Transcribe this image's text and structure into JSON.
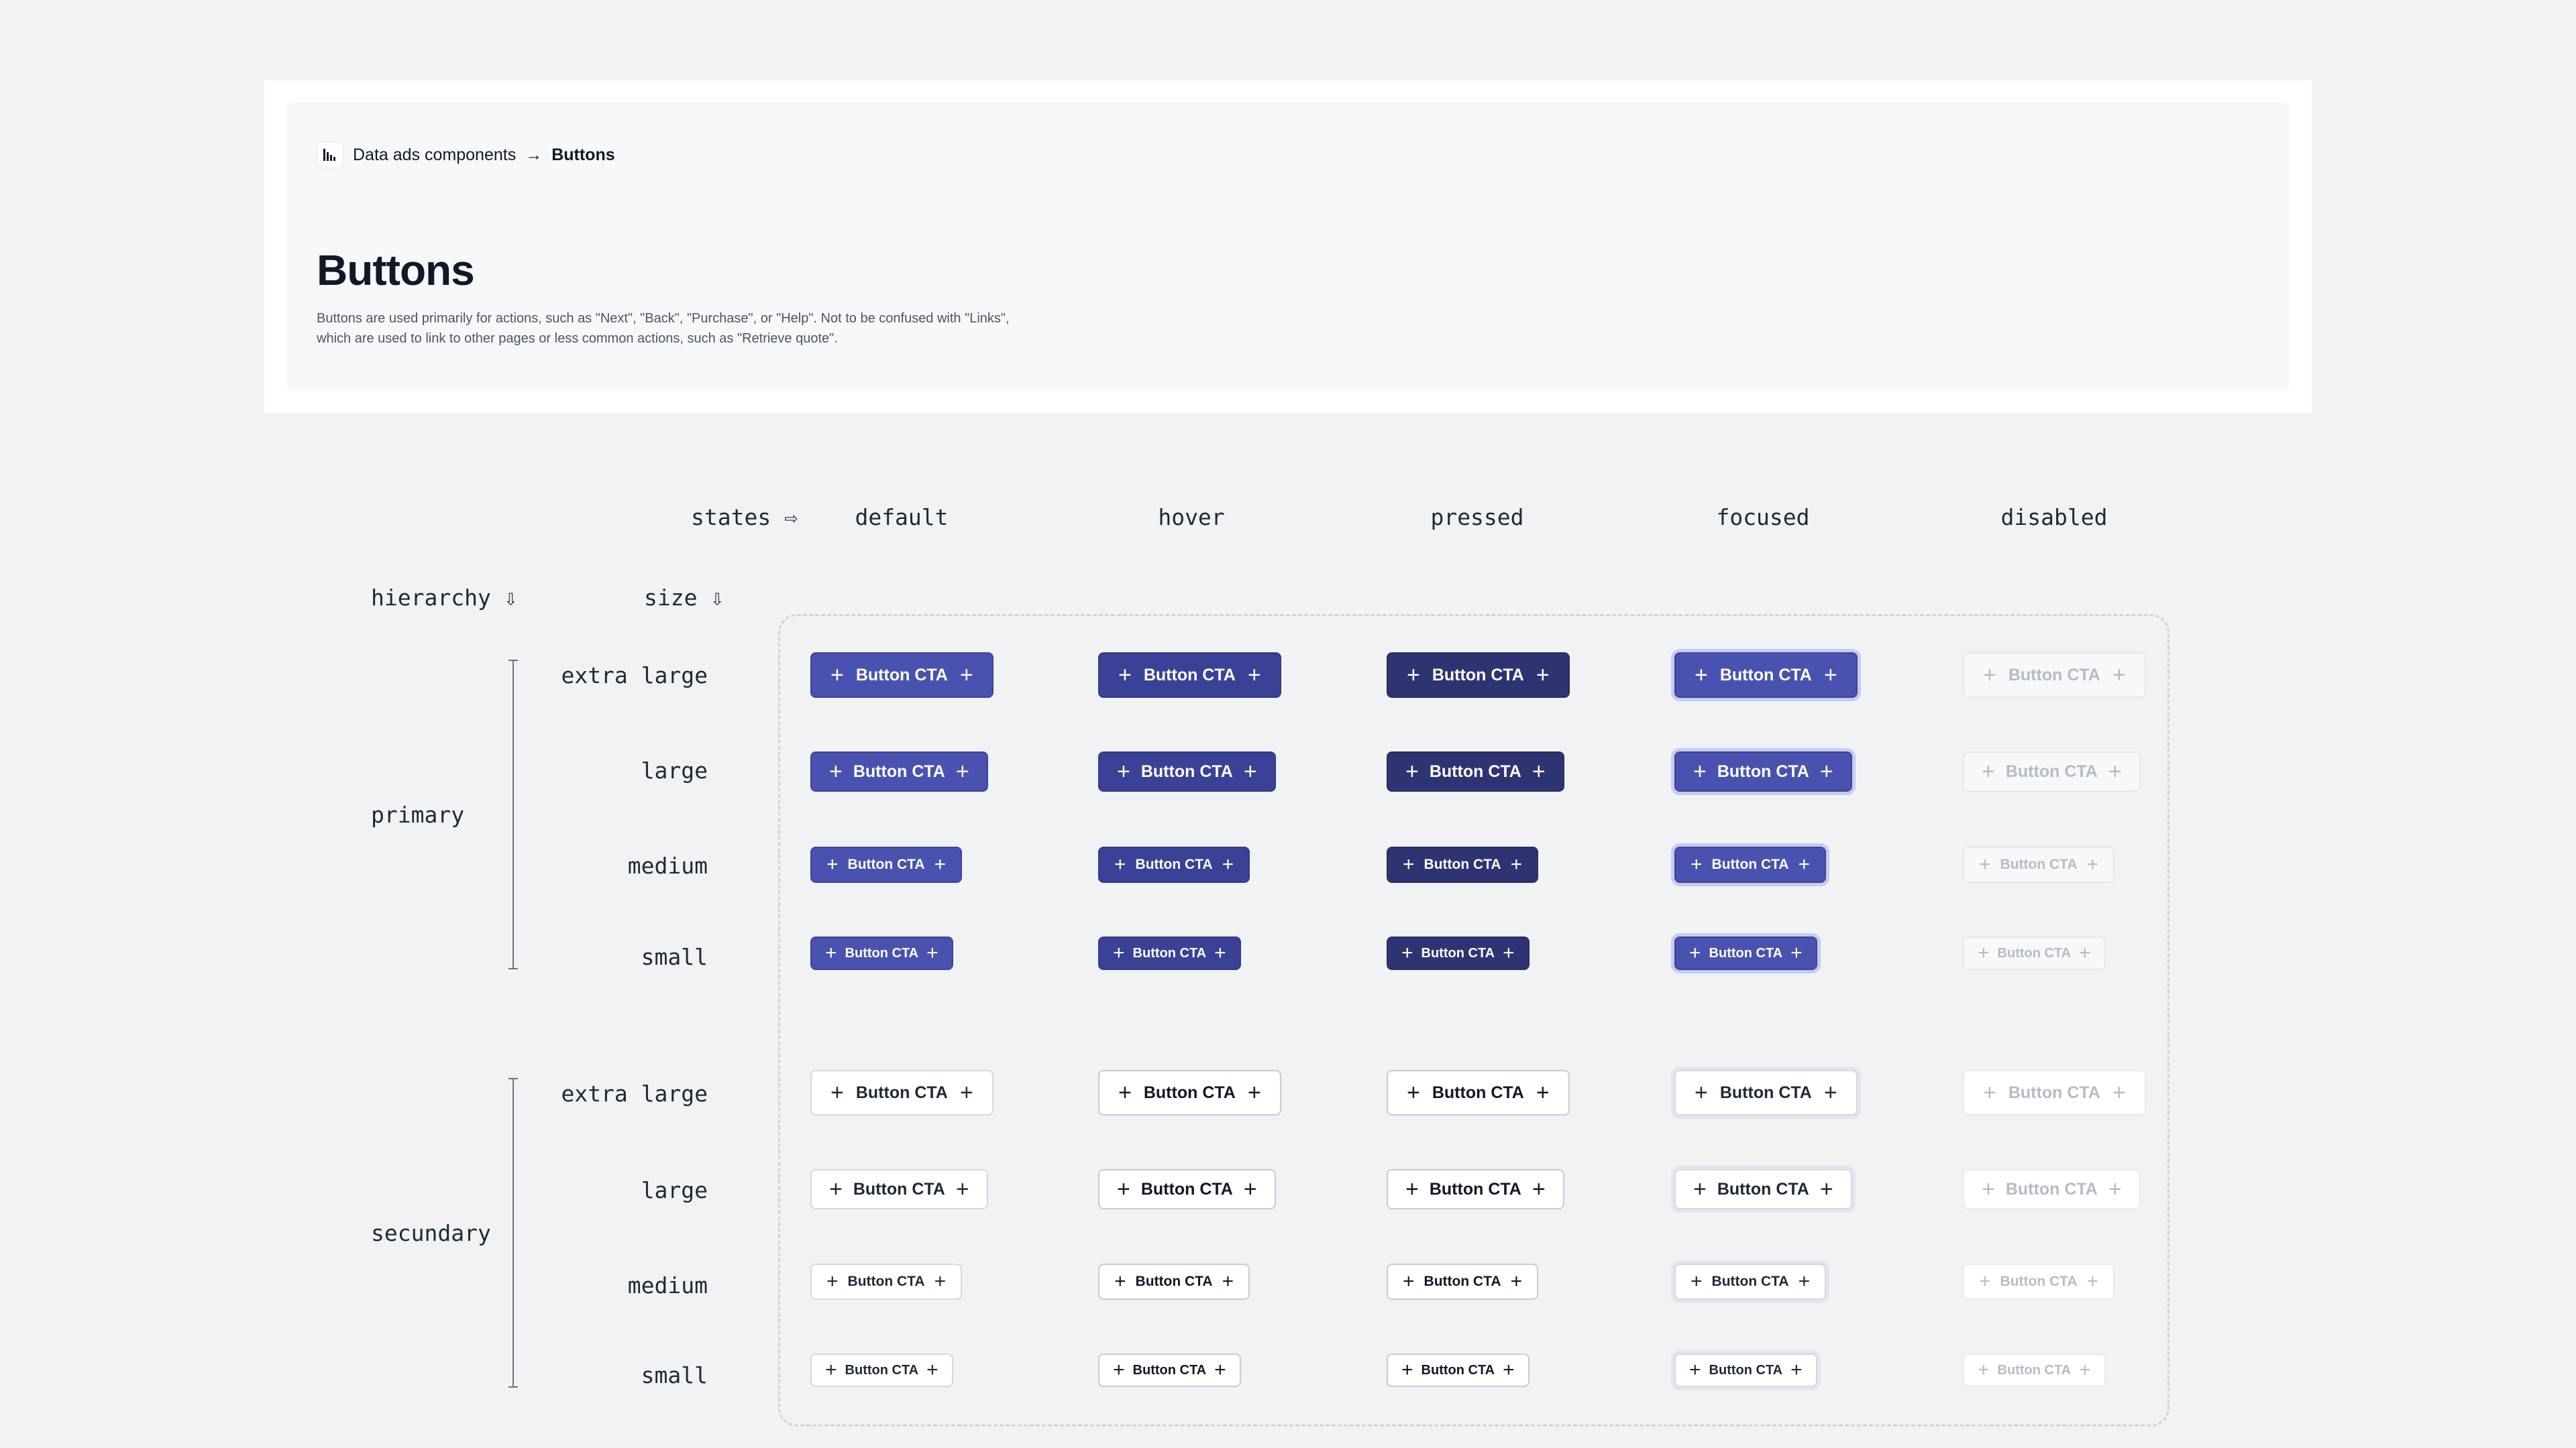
{
  "breadcrumb": {
    "logo_icon": "bar-chart-logo-icon",
    "parent": "Data ads components",
    "arrow": "→",
    "current": "Buttons"
  },
  "page": {
    "title": "Buttons",
    "description": "Buttons are used primarily for actions, such as \"Next\", \"Back\", \"Purchase\", or \"Help\". Not to be confused with \"Links\", which are used to link to other pages or less common actions, such as \"Retrieve quote\"."
  },
  "matrix": {
    "states_label": "states ⇨",
    "hierarchy_label": "hierarchy ⇩",
    "size_label": "size ⇩",
    "states": [
      "default",
      "hover",
      "pressed",
      "focused",
      "disabled"
    ],
    "hierarchies": [
      "primary",
      "secundary"
    ],
    "sizes": [
      "extra large",
      "large",
      "medium",
      "small"
    ],
    "button_label": "Button CTA",
    "button_icon": "plus-icon"
  },
  "colors": {
    "primary_default": "#4a52b0",
    "primary_hover": "#3a4196",
    "primary_pressed": "#2e3472",
    "focus_ring": "#c7cbf0",
    "disabled_text": "#b6bcc6"
  }
}
